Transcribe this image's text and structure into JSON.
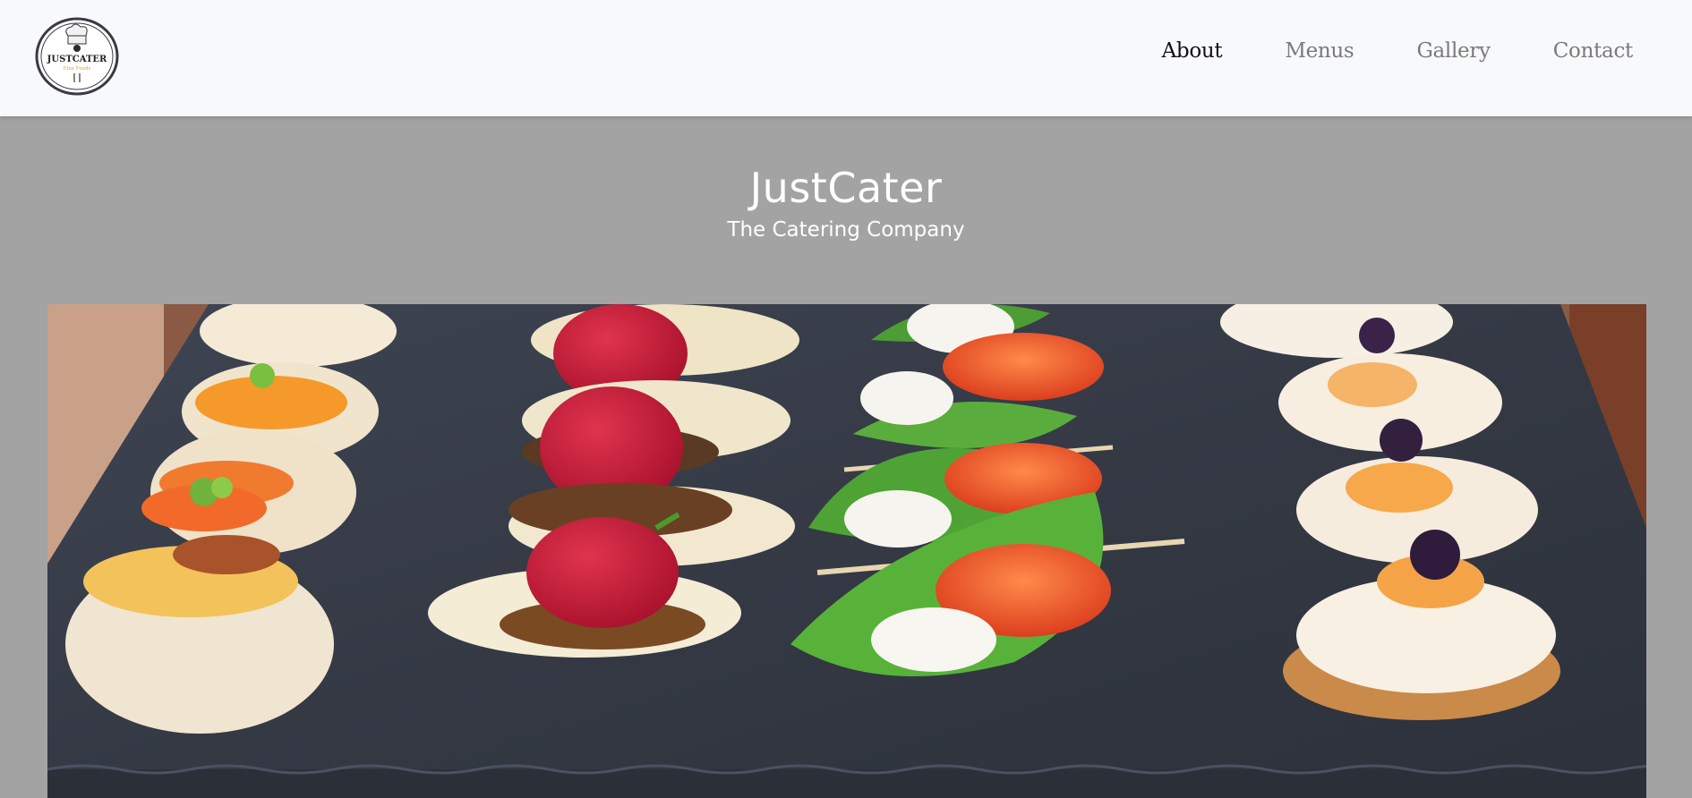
{
  "nav": {
    "logo": {
      "text": "JUSTCATER",
      "tagline": "Fine Foods",
      "icon": "chef-hat-logo"
    },
    "links": [
      {
        "label": "About",
        "active": true
      },
      {
        "label": "Menus",
        "active": false
      },
      {
        "label": "Gallery",
        "active": false
      },
      {
        "label": "Contact",
        "active": false
      }
    ]
  },
  "hero": {
    "title": "JustCater",
    "subtitle": "The Catering Company",
    "image": "canapes-on-slate-photo"
  },
  "colors": {
    "navbar_bg": "#f8f9fa",
    "page_bg": "#a3a3a3",
    "active_link": "#111111",
    "inactive_link": "#7a7a7a",
    "hero_text": "#ffffff"
  }
}
